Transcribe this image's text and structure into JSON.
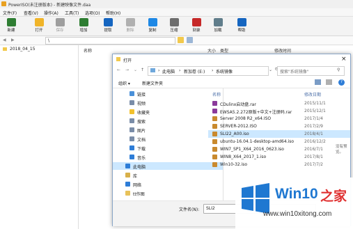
{
  "window": {
    "title": "PowerISO(未注册版本) - 新建映像文件.daa"
  },
  "menu": [
    "文件(F)",
    "查看(V)",
    "操作(A)",
    "工具(T)",
    "选项(O)",
    "帮助(H)"
  ],
  "toolbar": {
    "buttons": [
      {
        "label": "新建",
        "color": "#2e7d32",
        "disabled": false
      },
      {
        "label": "打开",
        "color": "#f0b429",
        "disabled": false
      },
      {
        "label": "保存",
        "color": "#9e9e9e",
        "disabled": true
      },
      {
        "label": "增加",
        "color": "#2e7d32",
        "disabled": false
      },
      {
        "label": "提取",
        "color": "#1565c0",
        "disabled": false
      },
      {
        "label": "删除",
        "color": "#b0b0b0",
        "disabled": true
      },
      {
        "label": "复制",
        "color": "#1e88e5",
        "disabled": false
      },
      {
        "label": "压缩",
        "color": "#6d6d6d",
        "disabled": false
      },
      {
        "label": "刻录",
        "color": "#c62828",
        "disabled": false
      },
      {
        "label": "加载",
        "color": "#607d8b",
        "disabled": false
      },
      {
        "label": "帮助",
        "color": "#1565c0",
        "disabled": false
      }
    ]
  },
  "addressbar": {
    "path": "\\"
  },
  "left_pane": {
    "root": "2018_04_15"
  },
  "right_pane": {
    "columns": {
      "name": "名称",
      "size": "大小",
      "type": "类型",
      "modified": "修改时间"
    }
  },
  "dialog": {
    "title": "打开",
    "breadcrumb": [
      "此电脑",
      "新加卷 (E:)",
      "系统镜像"
    ],
    "search_placeholder": "搜索\"系统镜像\"",
    "organize_label": "组织 ▾",
    "new_folder_label": "新建文件夹",
    "tree": [
      {
        "label": "链接",
        "icon": "link-icon",
        "color": "#4a90d9"
      },
      {
        "label": "视频",
        "icon": "video-icon",
        "color": "#7a8da8"
      },
      {
        "label": "收藏夹",
        "icon": "star-icon",
        "color": "#f2c12e"
      },
      {
        "label": "搜索",
        "icon": "search-icon",
        "color": "#7a8da8"
      },
      {
        "label": "图片",
        "icon": "picture-icon",
        "color": "#7a8da8"
      },
      {
        "label": "文档",
        "icon": "document-icon",
        "color": "#7a8da8"
      },
      {
        "label": "下载",
        "icon": "download-icon",
        "color": "#2e7dd7"
      },
      {
        "label": "音乐",
        "icon": "music-icon",
        "color": "#2e7dd7"
      },
      {
        "label": "此电脑",
        "icon": "computer-icon",
        "color": "#2e7dd7",
        "selected": true
      },
      {
        "label": "库",
        "icon": "library-icon",
        "color": "#d8b04a"
      },
      {
        "label": "网络",
        "icon": "network-icon",
        "color": "#2e7dd7"
      },
      {
        "label": "tt作图",
        "icon": "folder-icon",
        "color": "#e8c25a"
      }
    ],
    "files_header": {
      "name": "名称",
      "modified": "修改日期"
    },
    "files": [
      {
        "name": "CDulinx启动盘.rar",
        "date": "2015/11/1",
        "color": "#8b3a9b"
      },
      {
        "name": "EWSA5.2.272原版+中文+注册码.rar",
        "date": "2015/12/1",
        "color": "#8b3a9b"
      },
      {
        "name": "Server 2008 R2_x64.ISO",
        "date": "2017/1/4",
        "color": "#c98a2e"
      },
      {
        "name": "SERVER-2012.ISO",
        "date": "2017/2/9",
        "color": "#c98a2e"
      },
      {
        "name": "SLI22_A00.iso",
        "date": "2018/4/1",
        "color": "#c98a2e",
        "selected": true
      },
      {
        "name": "ubuntu-16.04.1-desktop-amd64.iso",
        "date": "2016/12/2",
        "color": "#c98a2e"
      },
      {
        "name": "WIN7_SP1_X64_2016_0623.iso",
        "date": "2016/7/1",
        "color": "#c98a2e"
      },
      {
        "name": "WIN8_X64_2017_1.iso",
        "date": "2017/8/1",
        "color": "#c98a2e"
      },
      {
        "name": "Win10-32.iso",
        "date": "2017/7/2",
        "color": "#c98a2e"
      }
    ],
    "preview_text": "没有预览。",
    "filename_label": "文件名(N):",
    "filename_value": "SLI2"
  },
  "watermark": {
    "brand": "Win10",
    "brand_suffix": "之家",
    "url": "www.win10xitong.com",
    "logo_color": "#1f78d1",
    "accent_color": "#e03030"
  }
}
